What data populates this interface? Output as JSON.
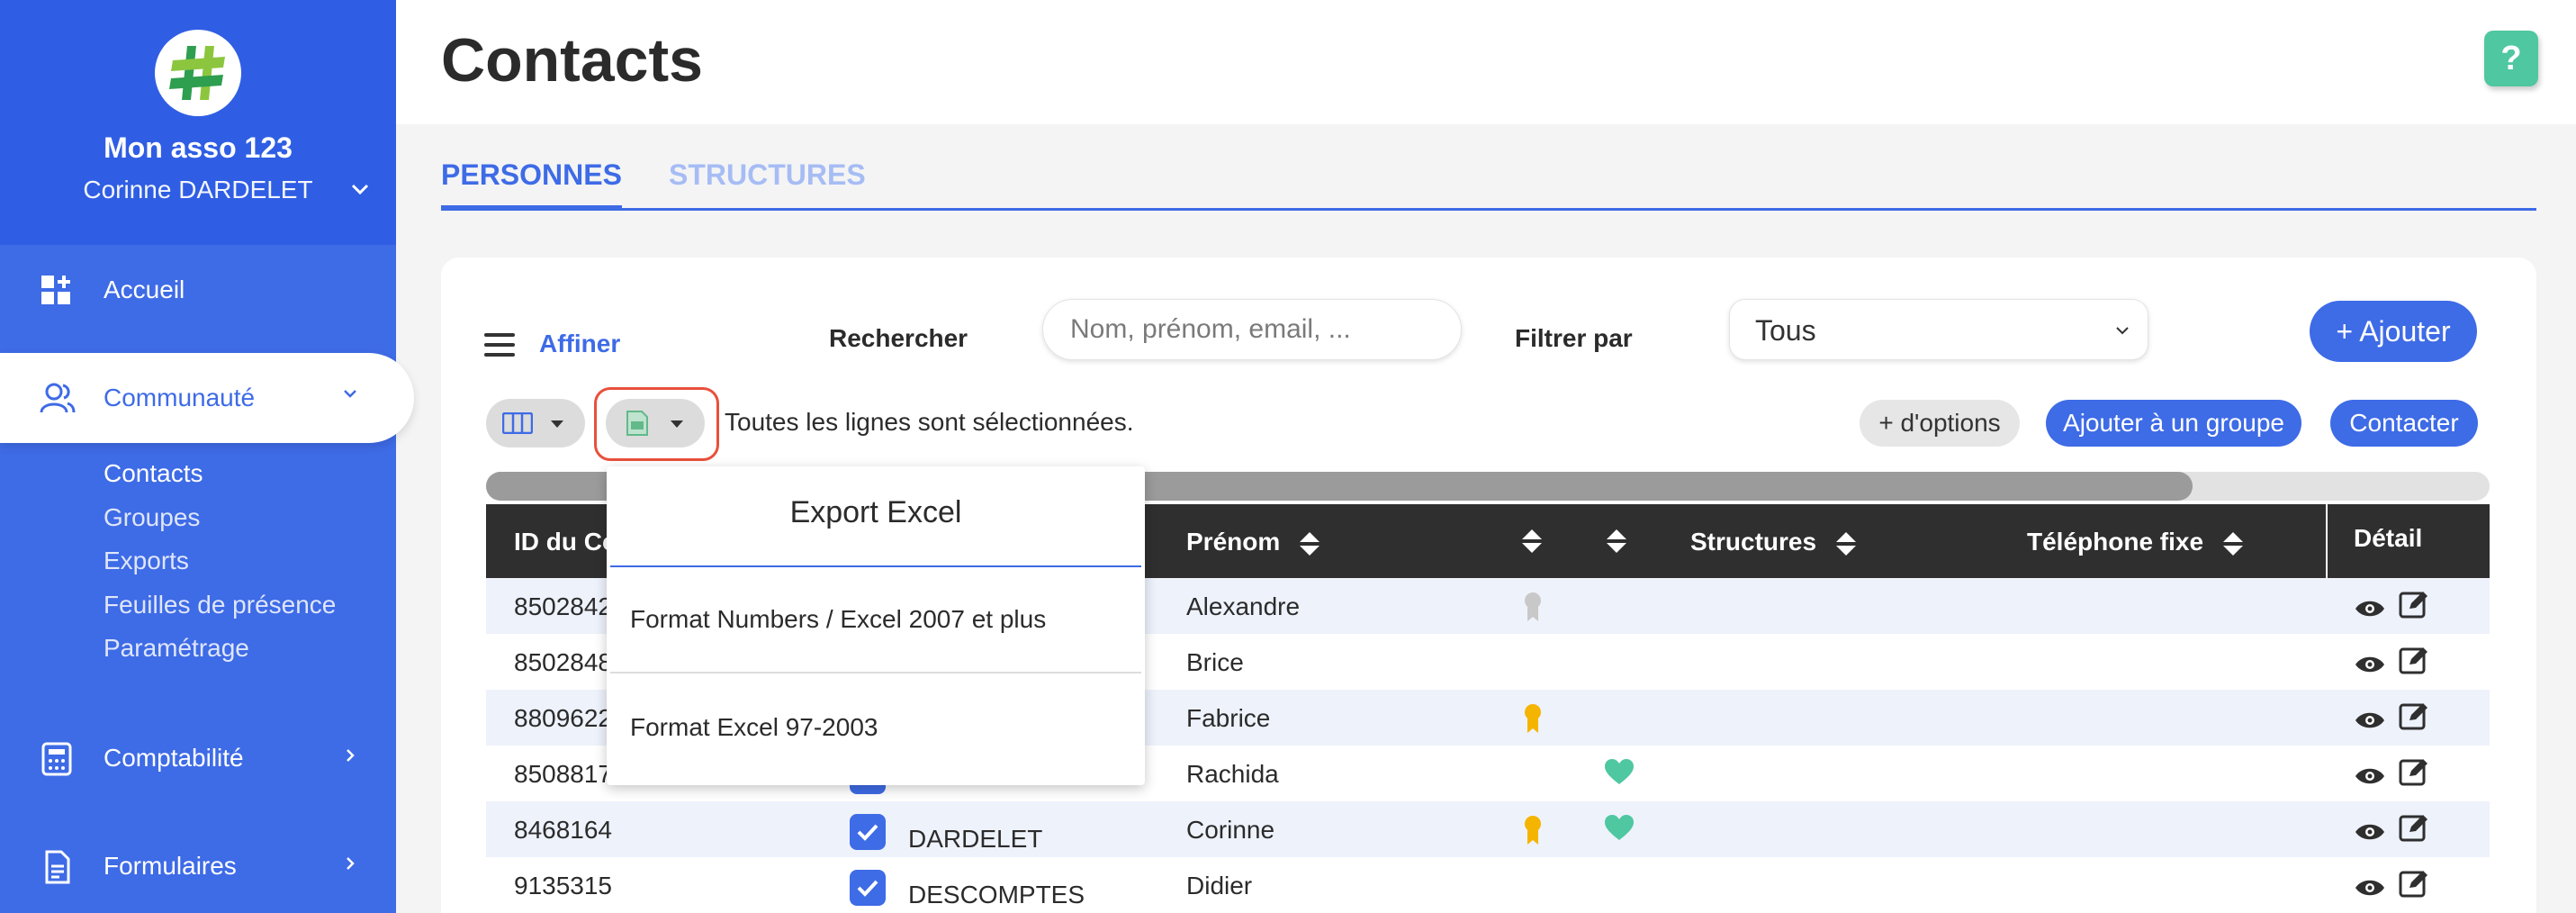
{
  "sidebar": {
    "org_name": "Mon asso 123",
    "user_name": "Corinne DARDELET",
    "nav": [
      {
        "label": "Accueil"
      },
      {
        "label": "Communauté"
      },
      {
        "label": "Comptabilité"
      },
      {
        "label": "Formulaires"
      }
    ],
    "subnav": [
      {
        "label": "Contacts"
      },
      {
        "label": "Groupes"
      },
      {
        "label": "Exports"
      },
      {
        "label": "Feuilles de présence"
      },
      {
        "label": "Paramétrage"
      }
    ]
  },
  "header": {
    "title": "Contacts",
    "help": "?"
  },
  "tabs": [
    {
      "label": "PERSONNES",
      "active": true
    },
    {
      "label": "STRUCTURES",
      "active": false
    }
  ],
  "toolbar": {
    "affiner": "Affiner",
    "search_label": "Rechercher",
    "search_placeholder": "Nom, prénom, email, ...",
    "filter_label": "Filtrer par",
    "filter_value": "Tous",
    "add_button": "+ Ajouter",
    "selection_text": "Toutes les lignes sont sélectionnées.",
    "options_button": "+ d'options",
    "group_button": "Ajouter à un groupe",
    "contact_button": "Contacter"
  },
  "table": {
    "headers": {
      "id": "ID du Co",
      "prenom": "Prénom",
      "structures": "Structures",
      "telephone": "Téléphone fixe",
      "detail": "Détail"
    },
    "rows": [
      {
        "id": "8502842",
        "nom": "",
        "prenom": "Alexandre",
        "medal": "grey",
        "heart": false,
        "checked": false
      },
      {
        "id": "8502848",
        "nom": "",
        "prenom": "Brice",
        "medal": "",
        "heart": false,
        "checked": false
      },
      {
        "id": "8809622",
        "nom": "",
        "prenom": "Fabrice",
        "medal": "gold",
        "heart": false,
        "checked": false
      },
      {
        "id": "8508817",
        "nom": "",
        "prenom": "Rachida",
        "medal": "",
        "heart": true,
        "checked": true
      },
      {
        "id": "8468164",
        "nom": "DARDELET",
        "prenom": "Corinne",
        "medal": "gold",
        "heart": true,
        "checked": true
      },
      {
        "id": "9135315",
        "nom": "DESCOMPTES",
        "prenom": "Didier",
        "medal": "",
        "heart": false,
        "checked": true
      }
    ]
  },
  "export_menu": {
    "title": "Export Excel",
    "items": [
      {
        "label": "Format Numbers / Excel 2007 et plus"
      },
      {
        "label": "Format Excel 97-2003"
      }
    ]
  },
  "colors": {
    "primary": "#3e6be6",
    "sidebar_top": "#2f5ee4",
    "help_green": "#4fc7a0",
    "table_header": "#2f2f2f",
    "highlight_outline": "#e8503c",
    "heart": "#4fc7a0",
    "medal_gold": "#f4b400"
  }
}
